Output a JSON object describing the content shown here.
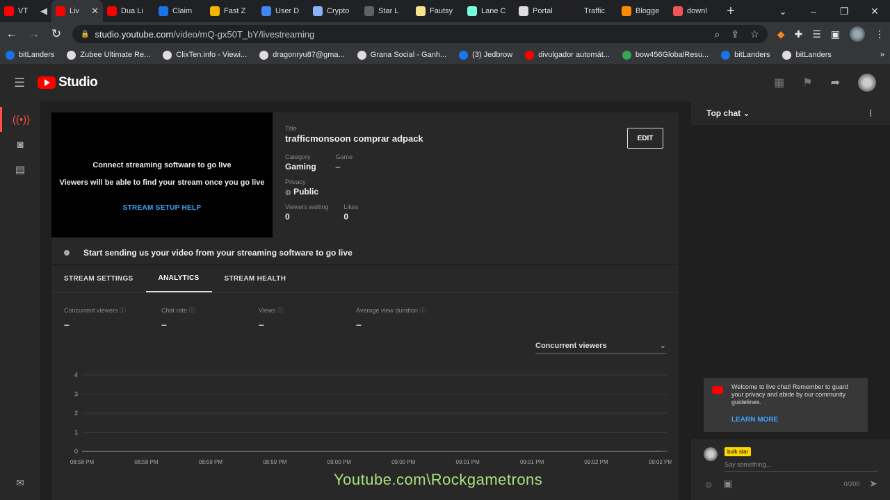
{
  "browser": {
    "tabs": [
      {
        "label": "VT",
        "color": "#ff0000"
      },
      {
        "label": "Liv",
        "color": "#ff0000",
        "active": true
      },
      {
        "label": "Dua Li",
        "color": "#ff0000"
      },
      {
        "label": "Claim",
        "color": "#1a73e8"
      },
      {
        "label": "Fast Z",
        "color": "#f5b400"
      },
      {
        "label": "User D",
        "color": "#4285f4"
      },
      {
        "label": "Crypto",
        "color": "#8ab4f8"
      },
      {
        "label": "Star L",
        "color": "#5f6368"
      },
      {
        "label": "Fautsy",
        "color": "#f6e58d"
      },
      {
        "label": "Lane C",
        "color": "#7fd"
      },
      {
        "label": "Portal",
        "color": "#ddd"
      },
      {
        "label": "Traffic",
        "color": "#222"
      },
      {
        "label": "Blogge",
        "color": "#ff8c00"
      },
      {
        "label": "downl",
        "color": "#e55"
      }
    ],
    "url_host": "studio.youtube.com",
    "url_path": "/video/mQ-gx50T_bY/livestreaming",
    "bookmarks": [
      {
        "label": "bitLanders",
        "color": "#1a73e8"
      },
      {
        "label": "Zubee Ultimate Re...",
        "color": "#ddd"
      },
      {
        "label": "ClixTen.info - Viewi...",
        "color": "#ddd"
      },
      {
        "label": "dragonryu87@gma...",
        "color": "#ddd"
      },
      {
        "label": "Grana Social - Ganh...",
        "color": "#ddd"
      },
      {
        "label": "(3) Jedbrow",
        "color": "#1877f2"
      },
      {
        "label": "divulgador automát...",
        "color": "#ff0000"
      },
      {
        "label": "bow456GlobalResu...",
        "color": "#34a853"
      },
      {
        "label": "bitLanders",
        "color": "#1a73e8"
      },
      {
        "label": "bitLanders",
        "color": "#ddd"
      }
    ]
  },
  "studio": {
    "logo_text": "Studio"
  },
  "stream": {
    "preview_line1": "Connect streaming software to go live",
    "preview_line2": "Viewers will be able to find your stream once you go live",
    "setup_help": "STREAM SETUP HELP",
    "title_label": "Title",
    "title": "trafficmonsoon comprar adpack",
    "category_label": "Category",
    "category": "Gaming",
    "game_label": "Game",
    "game": "–",
    "privacy_label": "Privacy",
    "privacy": "Public",
    "viewers_waiting_label": "Viewers waiting",
    "viewers_waiting": "0",
    "likes_label": "Likes",
    "likes": "0",
    "edit_label": "EDIT",
    "status": "Start sending us your video from your streaming software to go live"
  },
  "tabs": [
    "STREAM SETTINGS",
    "ANALYTICS",
    "STREAM HEALTH"
  ],
  "metrics": [
    {
      "label": "Concurrent viewers",
      "value": "–"
    },
    {
      "label": "Chat rate",
      "value": "–"
    },
    {
      "label": "Views",
      "value": "–"
    },
    {
      "label": "Average view duration",
      "value": "–"
    }
  ],
  "dropdown": "Concurrent viewers",
  "chart_data": {
    "type": "line",
    "x": [
      "08:58 PM",
      "08:58 PM",
      "08:59 PM",
      "08:59 PM",
      "09:00 PM",
      "09:00 PM",
      "09:01 PM",
      "09:01 PM",
      "09:02 PM",
      "09:02 PM"
    ],
    "y_ticks": [
      0,
      1,
      2,
      3,
      4
    ],
    "ylim": [
      0,
      4
    ],
    "series": [
      {
        "values": [
          0,
          0,
          0,
          0,
          0,
          0,
          0,
          0,
          0,
          0
        ]
      }
    ],
    "grid": true
  },
  "chat": {
    "header": "Top chat",
    "welcome": "Welcome to live chat! Remember to guard your privacy and abide by our community guidelines.",
    "learn_more": "LEARN MORE",
    "user_badge": "bulk star",
    "placeholder": "Say something...",
    "count": "0/200"
  },
  "watermark": "Youtube.com\\Rockgametrons"
}
